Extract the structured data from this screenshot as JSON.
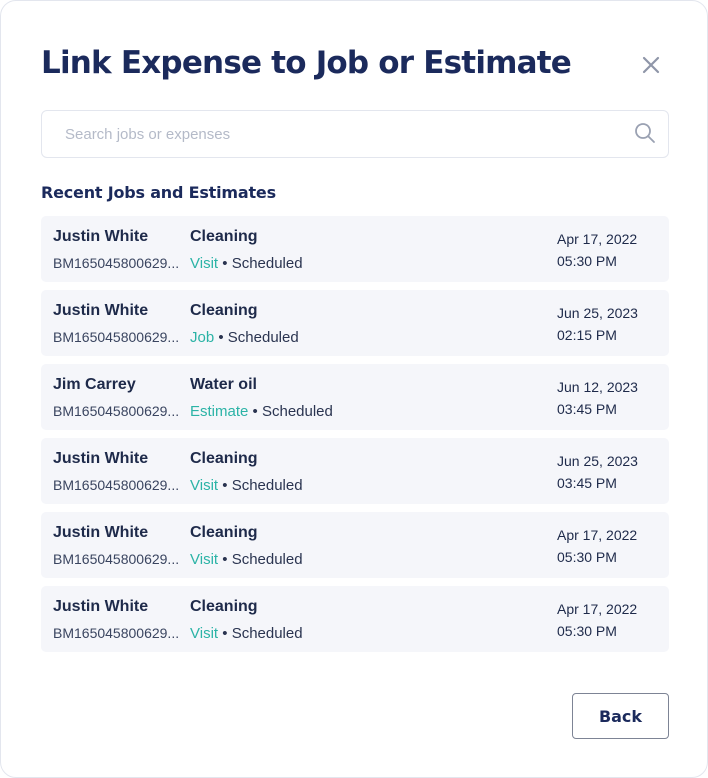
{
  "modal": {
    "title": "Link Expense to Job or Estimate",
    "close_icon": "close-icon"
  },
  "search": {
    "placeholder": "Search jobs or expenses",
    "value": "",
    "icon": "search-icon"
  },
  "section": {
    "title": "Recent Jobs and Estimates"
  },
  "items": [
    {
      "name": "Justin White",
      "ref": "BM165045800629...",
      "service": "Cleaning",
      "kind": "Visit",
      "separator": "•",
      "status": "Scheduled",
      "date": "Apr 17, 2022",
      "time": "05:30 PM"
    },
    {
      "name": "Justin White",
      "ref": "BM165045800629...",
      "service": "Cleaning",
      "kind": "Job",
      "separator": "•",
      "status": "Scheduled",
      "date": "Jun 25, 2023",
      "time": "02:15 PM"
    },
    {
      "name": "Jim Carrey",
      "ref": "BM165045800629...",
      "service": "Water oil",
      "kind": "Estimate",
      "separator": "•",
      "status": "Scheduled",
      "date": "Jun 12, 2023",
      "time": "03:45 PM"
    },
    {
      "name": "Justin White",
      "ref": "BM165045800629...",
      "service": "Cleaning",
      "kind": "Visit",
      "separator": "•",
      "status": "Scheduled",
      "date": "Jun 25, 2023",
      "time": "03:45 PM"
    },
    {
      "name": "Justin White",
      "ref": "BM165045800629...",
      "service": "Cleaning",
      "kind": "Visit",
      "separator": "•",
      "status": "Scheduled",
      "date": "Apr 17, 2022",
      "time": "05:30 PM"
    },
    {
      "name": "Justin White",
      "ref": "BM165045800629...",
      "service": "Cleaning",
      "kind": "Visit",
      "separator": "•",
      "status": "Scheduled",
      "date": "Apr 17, 2022",
      "time": "05:30 PM"
    }
  ],
  "footer": {
    "back_label": "Back"
  },
  "colors": {
    "title": "#1b2a5c",
    "accent_teal": "#2bb3a6",
    "row_background": "#f5f6fa",
    "border": "#e3e6ee"
  }
}
